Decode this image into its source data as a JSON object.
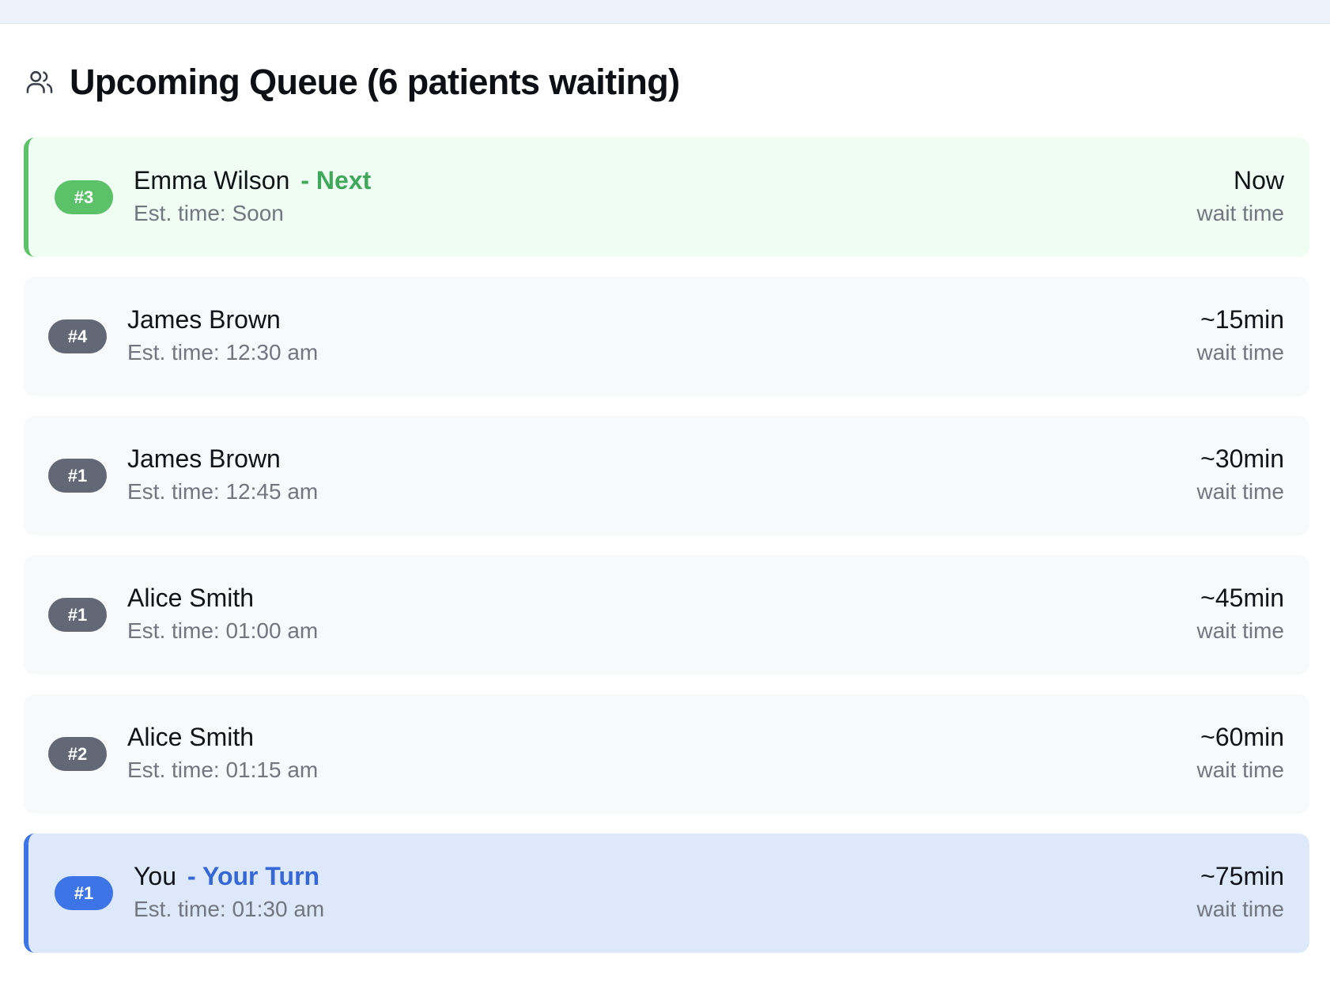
{
  "header": {
    "title": "Upcoming Queue (6 patients waiting)",
    "icon": "users-icon"
  },
  "queue": [
    {
      "badge": "#3",
      "name": "Emma Wilson",
      "tag": "- Next",
      "est": "Est. time: Soon",
      "wait": "Now",
      "wait_label": "wait time",
      "status": "next"
    },
    {
      "badge": "#4",
      "name": "James Brown",
      "tag": "",
      "est": "Est. time: 12:30 am",
      "wait": "~15min",
      "wait_label": "wait time",
      "status": "waiting"
    },
    {
      "badge": "#1",
      "name": "James Brown",
      "tag": "",
      "est": "Est. time: 12:45 am",
      "wait": "~30min",
      "wait_label": "wait time",
      "status": "waiting"
    },
    {
      "badge": "#1",
      "name": "Alice Smith",
      "tag": "",
      "est": "Est. time: 01:00 am",
      "wait": "~45min",
      "wait_label": "wait time",
      "status": "waiting"
    },
    {
      "badge": "#2",
      "name": "Alice Smith",
      "tag": "",
      "est": "Est. time: 01:15 am",
      "wait": "~60min",
      "wait_label": "wait time",
      "status": "waiting"
    },
    {
      "badge": "#1",
      "name": "You",
      "tag": "- Your Turn",
      "est": "Est. time: 01:30 am",
      "wait": "~75min",
      "wait_label": "wait time",
      "status": "you"
    }
  ],
  "colors": {
    "next_accent": "#5bc26a",
    "you_accent": "#3d74e6",
    "badge_default": "#636877"
  }
}
